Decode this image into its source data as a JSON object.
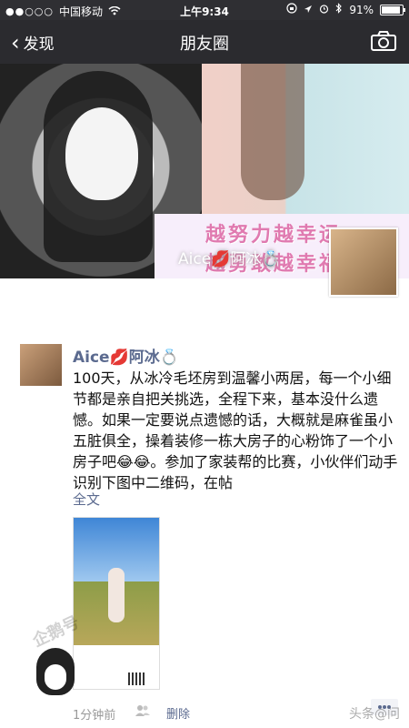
{
  "status_bar": {
    "signal": "●●○○○",
    "carrier": "中国移动",
    "wifi_icon": "wifi-icon",
    "time": "上午9:34",
    "battery": "91%",
    "battery_level": 0.91
  },
  "nav": {
    "back_label": "发现",
    "title": "朋友圈",
    "camera_icon": "camera-icon"
  },
  "cover": {
    "slogan_line1": "越努力越幸运",
    "slogan_line2": "越勇敢越幸福",
    "name": "Aice💋阿冰💍"
  },
  "post": {
    "author": "Aice💋阿冰💍",
    "content": "100天，从冰冷毛坯房到温馨小两居，每一个小细节都是亲自把关挑选，全程下来，基本没什么遗憾。如果一定要说点遗憾的话，大概就是麻雀虽小五脏俱全，操着装修一栋大房子的心粉饰了一个小房子吧😂😂。参加了家装帮的比赛，小伙伴们动手识别下图中二维码，在帖",
    "full_text_label": "全文",
    "time_ago": "1分钟前",
    "delete_label": "删除"
  },
  "watermark": {
    "text": "企鹅号",
    "brand": "头条@问"
  }
}
